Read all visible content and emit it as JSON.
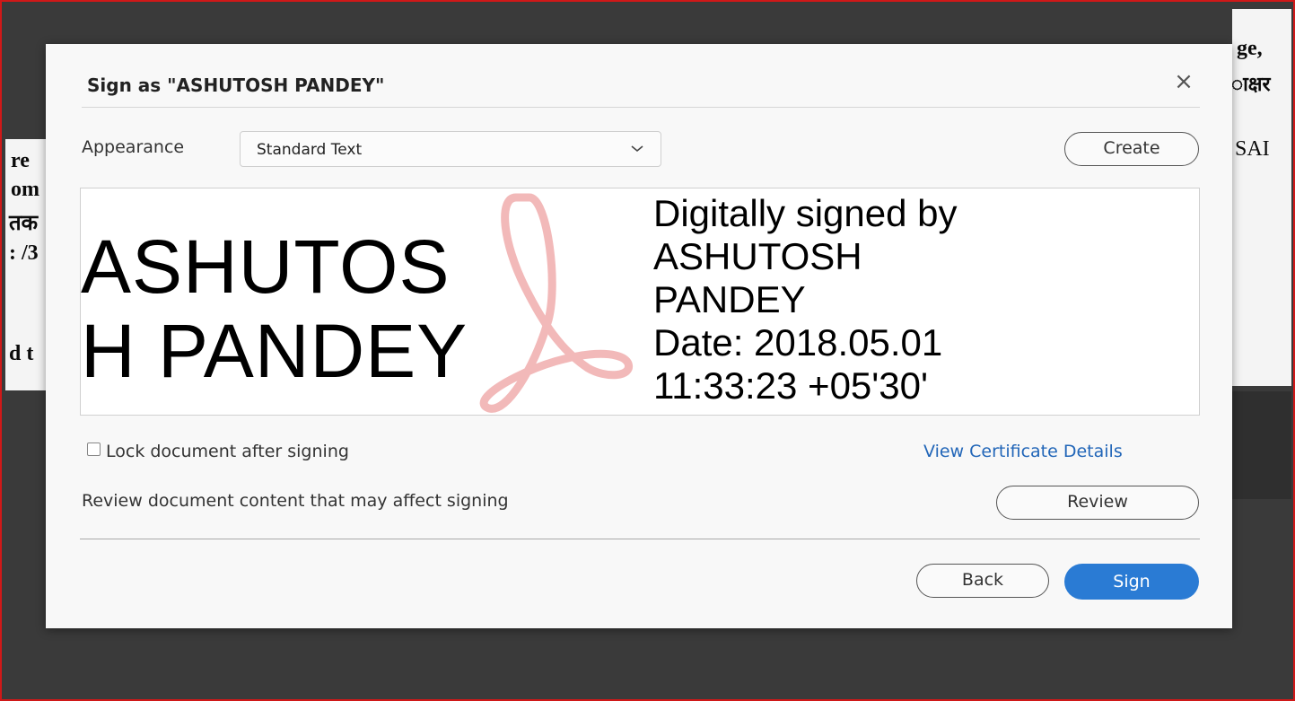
{
  "background": {
    "fragments": [
      "ge,",
      "ाक्षर",
      "SAI",
      "re",
      "om",
      "तक",
      ": /3",
      "d t"
    ]
  },
  "dialog": {
    "title": "Sign as \"ASHUTOSH PANDEY\"",
    "close_icon": "close-icon",
    "appearance_label": "Appearance",
    "appearance_value": "Standard Text",
    "create_label": "Create",
    "preview": {
      "name_line1": "ASHUTOS",
      "name_line2": "H PANDEY",
      "info_line1": "Digitally signed by",
      "info_line2": "ASHUTOSH",
      "info_line3": "PANDEY",
      "info_line4": "Date: 2018.05.01",
      "info_line5": "11:33:23 +05'30'"
    },
    "lock_label": "Lock document after signing",
    "lock_checked": false,
    "view_cert_label": "View Certificate Details",
    "review_text": "Review document content that may affect signing",
    "review_label": "Review",
    "back_label": "Back",
    "sign_label": "Sign"
  },
  "colors": {
    "accent": "#2a7bd4",
    "link": "#2266b8",
    "frame_border": "#d01818",
    "watermark": "#f2b9b9"
  }
}
